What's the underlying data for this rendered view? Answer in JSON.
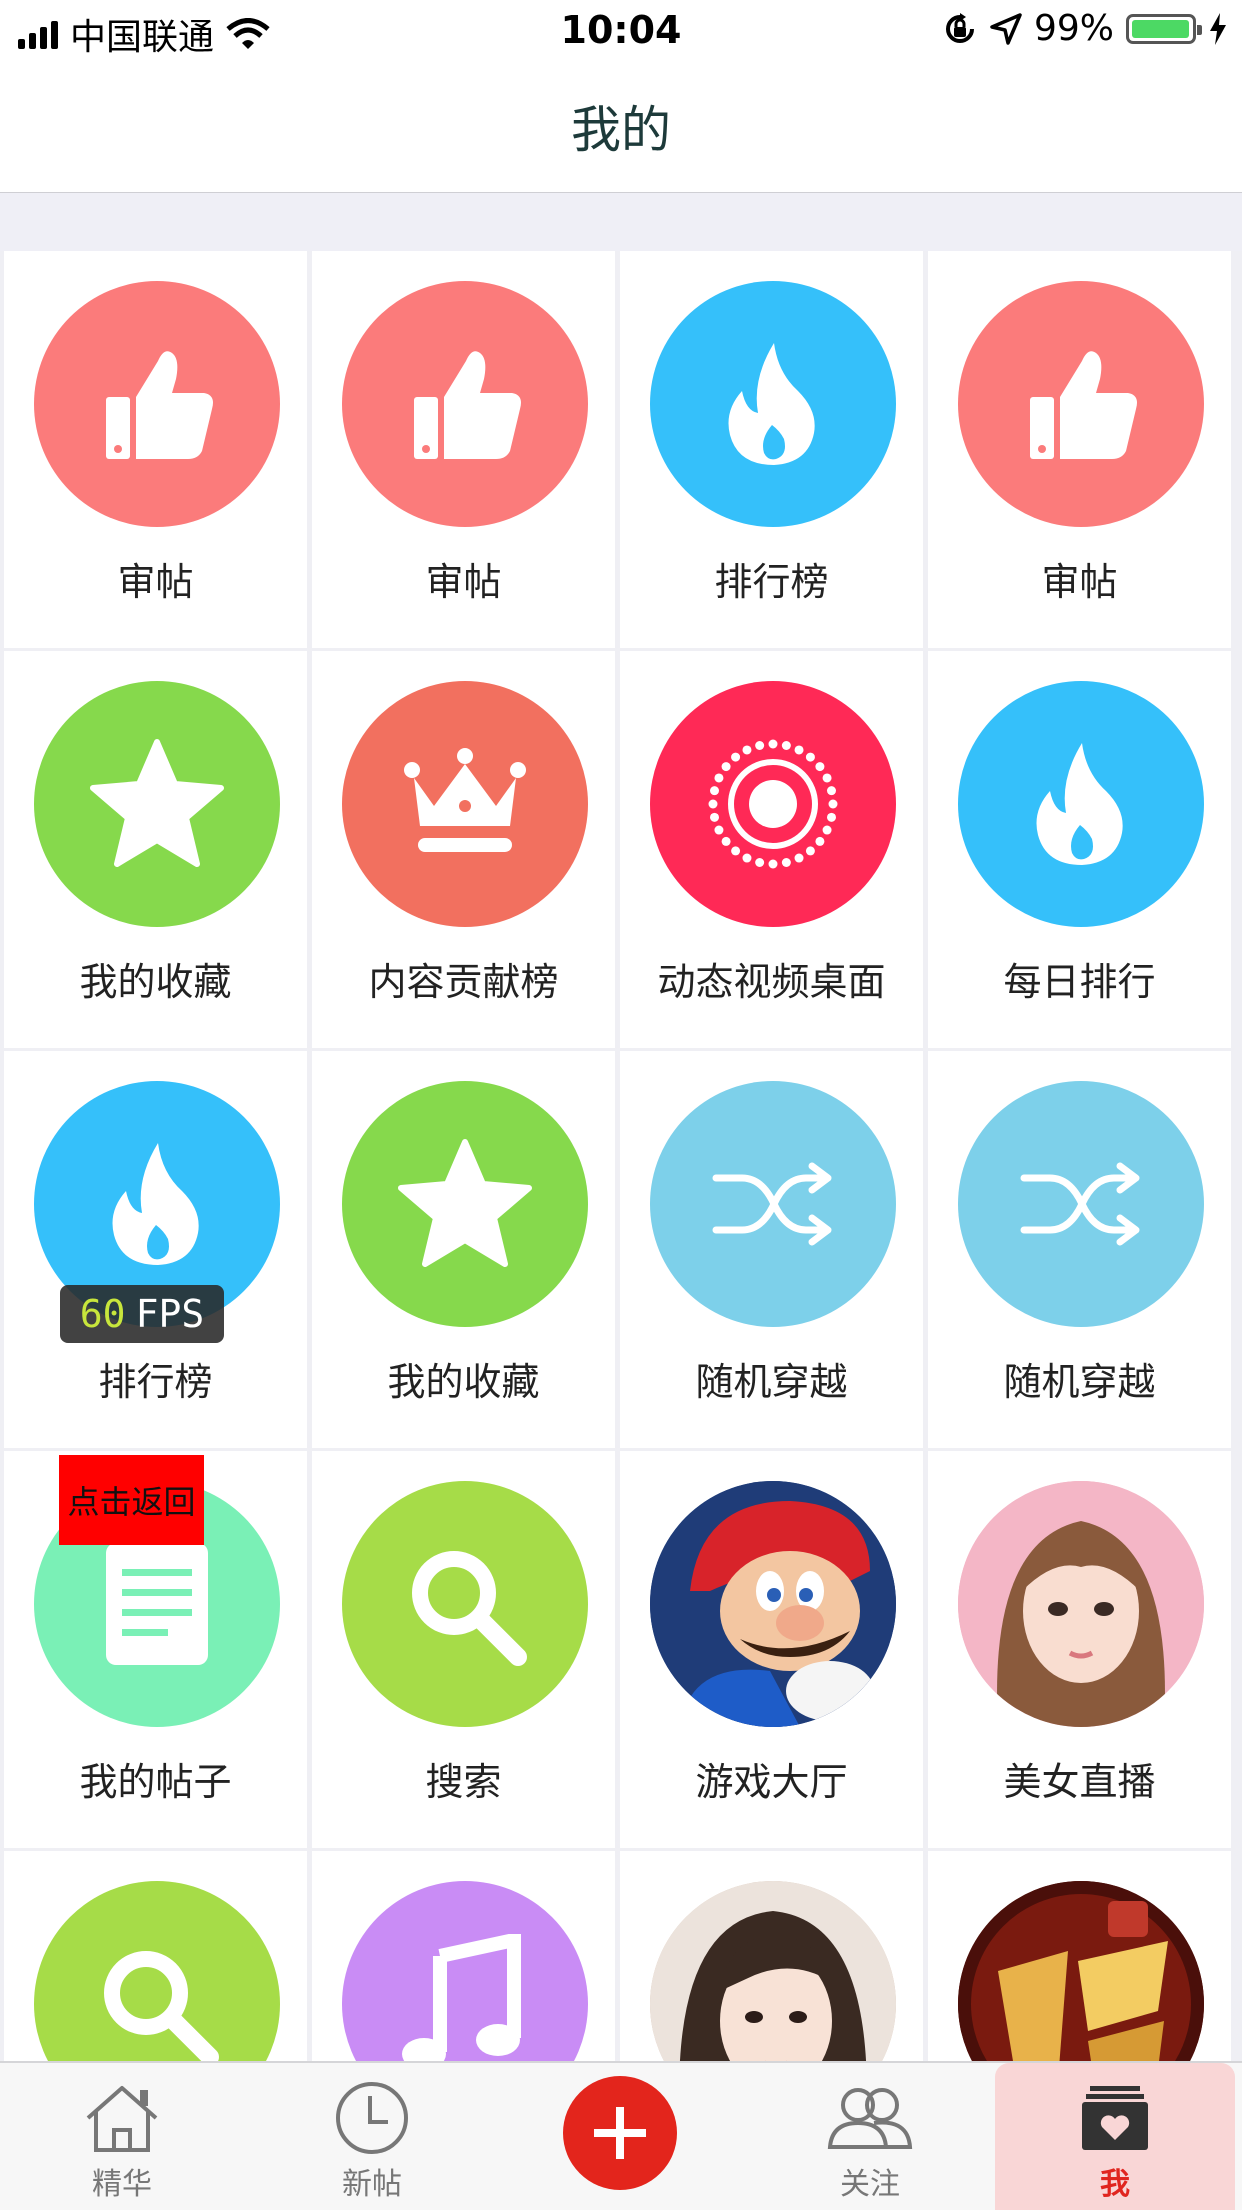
{
  "status_bar": {
    "carrier": "中国联通",
    "time": "10:04",
    "battery": "99%",
    "battery_level": 0.99,
    "icons": [
      "signal-icon",
      "wifi-icon",
      "orientation-lock-icon",
      "location-arrow-icon",
      "battery-icon",
      "charging-icon"
    ]
  },
  "nav": {
    "title": "我的"
  },
  "grid": {
    "items": [
      {
        "label": "审帖",
        "icon": "thumbs-up-icon",
        "color": "#fb7b7b"
      },
      {
        "label": "审帖",
        "icon": "thumbs-up-icon",
        "color": "#fb7b7b"
      },
      {
        "label": "排行榜",
        "icon": "flame-icon",
        "color": "#35c0fa"
      },
      {
        "label": "审帖",
        "icon": "thumbs-up-icon",
        "color": "#fb7b7b"
      },
      {
        "label": "我的收藏",
        "icon": "star-icon",
        "color": "#86d94c"
      },
      {
        "label": "内容贡献榜",
        "icon": "crown-icon",
        "color": "#f2705f"
      },
      {
        "label": "动态视频桌面",
        "icon": "record-ring-icon",
        "color": "#ff2956"
      },
      {
        "label": "每日排行",
        "icon": "flame-icon",
        "color": "#35c0fa"
      },
      {
        "label": "排行榜",
        "icon": "flame-icon",
        "color": "#35c0fa"
      },
      {
        "label": "我的收藏",
        "icon": "star-icon",
        "color": "#86d94c"
      },
      {
        "label": "随机穿越",
        "icon": "shuffle-icon",
        "color": "#7dd0ea"
      },
      {
        "label": "随机穿越",
        "icon": "shuffle-icon",
        "color": "#7dd0ea"
      },
      {
        "label": "我的帖子",
        "icon": "document-icon",
        "color": "#7af0b6"
      },
      {
        "label": "搜索",
        "icon": "search-icon",
        "color": "#a6dc48"
      },
      {
        "label": "游戏大厅",
        "icon": "game-character-image",
        "color": "#2f4f8f"
      },
      {
        "label": "美女直播",
        "icon": "live-host-image",
        "color": "#f4b6c6"
      },
      {
        "label": "",
        "icon": "search-icon",
        "color": "#a6dc48"
      },
      {
        "label": "",
        "icon": "music-note-icon",
        "color": "#c98cf5"
      },
      {
        "label": "",
        "icon": "portrait-image",
        "color": "#d7c0b0"
      },
      {
        "label": "",
        "icon": "game-logo-image",
        "color": "#6a1810"
      }
    ]
  },
  "fps": {
    "value": "60",
    "unit": "FPS"
  },
  "back_badge": {
    "label": "点击返回"
  },
  "tab_bar": {
    "tabs": [
      {
        "label": "精华",
        "icon": "home-icon"
      },
      {
        "label": "新帖",
        "icon": "clock-icon"
      },
      {
        "label": "",
        "icon": "plus-icon"
      },
      {
        "label": "关注",
        "icon": "users-icon"
      },
      {
        "label": "我",
        "icon": "profile-box-icon"
      }
    ],
    "active": "我",
    "accent_color": "#e3251c"
  }
}
